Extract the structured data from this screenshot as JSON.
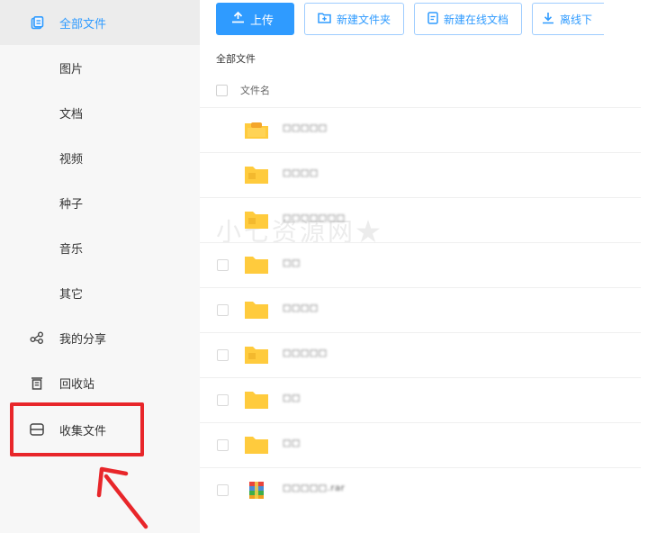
{
  "sidebar": {
    "items": [
      {
        "label": "全部文件",
        "icon": "all-files-icon",
        "active": true
      },
      {
        "label": "图片"
      },
      {
        "label": "文档"
      },
      {
        "label": "视频"
      },
      {
        "label": "种子"
      },
      {
        "label": "音乐"
      },
      {
        "label": "其它"
      },
      {
        "label": "我的分享",
        "icon": "share-icon"
      },
      {
        "label": "回收站",
        "icon": "trash-icon"
      },
      {
        "label": "收集文件",
        "icon": "collect-icon",
        "highlighted": true
      }
    ]
  },
  "toolbar": {
    "upload_label": "上传",
    "new_folder_label": "新建文件夹",
    "new_doc_label": "新建在线文档",
    "offline_download_label": "离线下"
  },
  "breadcrumb": "全部文件",
  "list": {
    "header_label": "文件名",
    "rows": [
      {
        "name": "□□□□□",
        "type": "folder-special"
      },
      {
        "name": "□□□□",
        "type": "folder"
      },
      {
        "name": "□□□□□□□",
        "type": "folder"
      },
      {
        "name": "□□",
        "type": "folder"
      },
      {
        "name": "□□□□",
        "type": "folder"
      },
      {
        "name": "□□□□□",
        "type": "folder"
      },
      {
        "name": "□□",
        "type": "folder"
      },
      {
        "name": "□□",
        "type": "folder"
      },
      {
        "name": "□□□□□.rar",
        "type": "archive"
      }
    ]
  },
  "watermark": "小七资源网★",
  "colors": {
    "accent": "#2f9bff",
    "highlight": "#e8262a",
    "folder": "#ffcb3d",
    "sidebar_bg": "#f7f7f7"
  }
}
